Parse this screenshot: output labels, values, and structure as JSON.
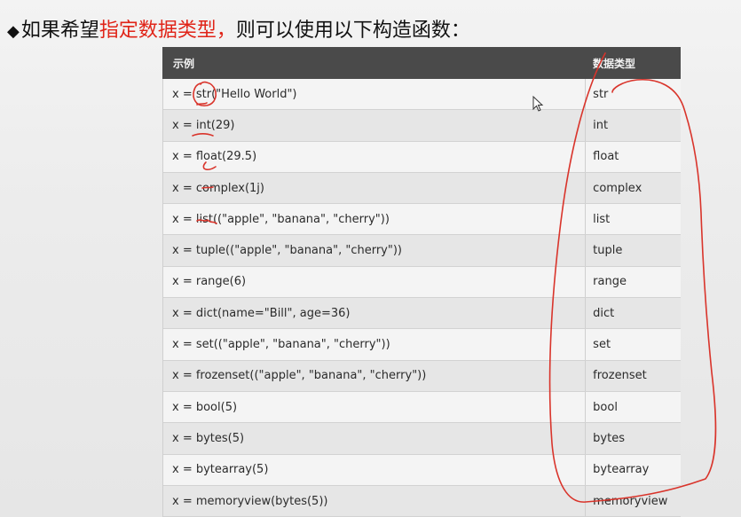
{
  "heading": {
    "bullet": "◆",
    "prefix": "如果希望",
    "highlight": "指定数据类型，",
    "suffix": "则可以使用以下构造函数："
  },
  "table": {
    "headers": [
      "示例",
      "数据类型"
    ],
    "rows": [
      {
        "example": "x = str(\"Hello World\")",
        "type": "str"
      },
      {
        "example": "x = int(29)",
        "type": "int"
      },
      {
        "example": "x = float(29.5)",
        "type": "float"
      },
      {
        "example": "x = complex(1j)",
        "type": "complex"
      },
      {
        "example": "x = list((\"apple\", \"banana\", \"cherry\"))",
        "type": "list"
      },
      {
        "example": "x = tuple((\"apple\", \"banana\", \"cherry\"))",
        "type": "tuple"
      },
      {
        "example": "x = range(6)",
        "type": "range"
      },
      {
        "example": "x = dict(name=\"Bill\", age=36)",
        "type": "dict"
      },
      {
        "example": "x = set((\"apple\", \"banana\", \"cherry\"))",
        "type": "set"
      },
      {
        "example": "x = frozenset((\"apple\", \"banana\", \"cherry\"))",
        "type": "frozenset"
      },
      {
        "example": "x = bool(5)",
        "type": "bool"
      },
      {
        "example": "x = bytes(5)",
        "type": "bytes"
      },
      {
        "example": "x = bytearray(5)",
        "type": "bytearray"
      },
      {
        "example": "x = memoryview(bytes(5))",
        "type": "memoryview"
      }
    ]
  },
  "colors": {
    "highlight_text": "#e02418",
    "header_bg": "#4a4a4a",
    "annotation_ink": "#d9342b"
  },
  "icons": [
    "mouse-pointer-icon"
  ]
}
